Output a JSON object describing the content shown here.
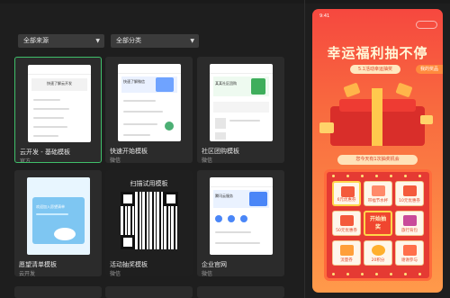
{
  "filters": {
    "source": "全部来源",
    "category": "全部分类"
  },
  "templates": [
    {
      "name": "云开发 - 基础模板",
      "source": "官方",
      "thumb_title": "快速了解云开发"
    },
    {
      "name": "快速开始模板",
      "source": "微信",
      "thumb_title": "快速了解微信"
    },
    {
      "name": "社区团购模板",
      "source": "微信",
      "thumb_title": "某某社区团购"
    },
    {
      "name": "愿望清单模板",
      "source": "云开发",
      "thumb_title": "欢迎加入愿望清单"
    },
    {
      "name": "活动抽奖模板",
      "source": "微信",
      "thumb_title": "扫描试用模板"
    },
    {
      "name": "企业官网",
      "source": "微信",
      "thumb_title": "腾讯云服务"
    }
  ],
  "preview": {
    "time": "9:41",
    "title": "幸运福利抽不停",
    "activity_tag": "5.1活动幸运抽奖",
    "my_prize": "我的奖品",
    "chances": "您今天有1次抽奖机会",
    "start_button": "开始抽奖",
    "prizes": [
      "6元优惠券",
      "带福节水杯",
      "10元优惠券",
      "50元优惠券",
      "",
      "旅行背包",
      "流量券",
      "20积分",
      "谢谢参与"
    ]
  }
}
